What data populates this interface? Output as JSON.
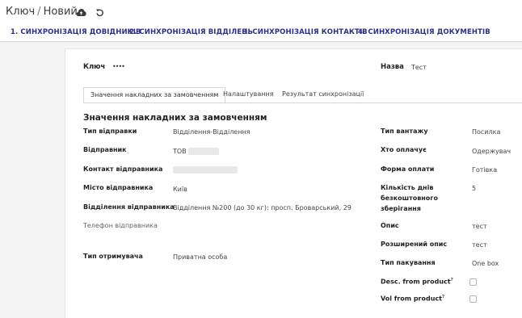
{
  "breadcrumb": {
    "parent": "Ключ",
    "separator": "/",
    "current": "Новий"
  },
  "icons": {
    "save": "cloud-upload-icon",
    "discard": "undo-icon"
  },
  "sync_tabs": [
    "1. СИНХРОНІЗАЦІЯ ДОВІДНИКІВ",
    "2. СИНХРОНІЗАЦІЯ ВІДДІЛЕНЬ",
    "3. СИНХРОНІЗАЦІЯ КОНТАКТІВ",
    "4. СИНХРОНІЗАЦІЯ ДОКУМЕНТІВ"
  ],
  "header": {
    "key_label": "Ключ",
    "key_value": "••••",
    "name_label": "Назва",
    "name_value": "Тест"
  },
  "form_tabs": [
    "Значення накладних за замовченням",
    "Налаштування",
    "Результат синхронізації"
  ],
  "section_title": "Значення накладних за замовченням",
  "left_fields": {
    "ship_type": {
      "label": "Тип відправки",
      "value": "Відділення-Відділення"
    },
    "sender": {
      "label": "Відправник",
      "value": "ТОВ"
    },
    "contact": {
      "label": "Контакт відправника",
      "value": ""
    },
    "city": {
      "label": "Місто відправника",
      "value": "Київ"
    },
    "branch": {
      "label": "Відділення відправника",
      "value": "Відділення №200 (до 30 кг): просп. Броварський, 29"
    },
    "phone": {
      "label": "Телефон відправника",
      "value": ""
    },
    "recipient": {
      "label": "Тип отримувача",
      "value": "Приватна особа"
    }
  },
  "right_fields": {
    "cargo": {
      "label": "Тип вантажу",
      "value": "Посилка"
    },
    "payer": {
      "label": "Хто оплачує",
      "value": "Одержувач"
    },
    "payment": {
      "label": "Форма оплати",
      "value": "Готівка"
    },
    "free_days": {
      "label_1": "Кількість днів",
      "label_2": "безкоштовного",
      "label_3": "зберігання",
      "value": "5"
    },
    "desc": {
      "label": "Опис",
      "value": "тест"
    },
    "ext_desc": {
      "label": "Розширений опис",
      "value": "тест"
    },
    "pack": {
      "label": "Тип пакування",
      "value": "One box"
    },
    "desc_from_product": {
      "label": "Desc. from product",
      "help": "?",
      "checked": false
    },
    "vol_from_product": {
      "label": "Vol from product",
      "help": "?",
      "checked": false
    }
  }
}
